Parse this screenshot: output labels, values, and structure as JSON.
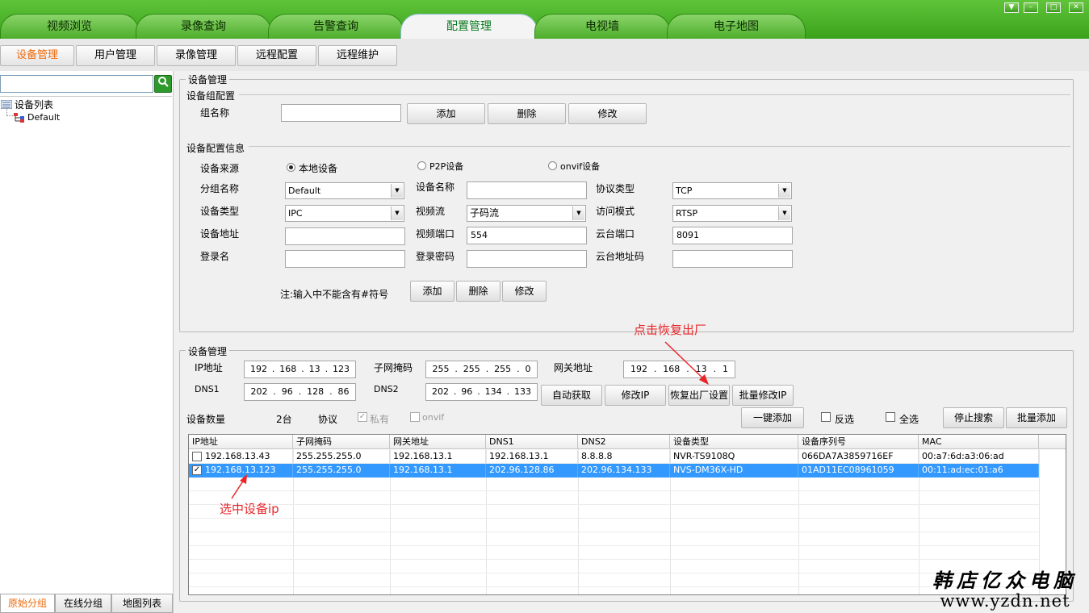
{
  "main_tabs": [
    "视频浏览",
    "录像查询",
    "告警查询",
    "配置管理",
    "电视墙",
    "电子地图"
  ],
  "window_controls": [
    "▼",
    "–",
    "□",
    "✕"
  ],
  "sub_tabs": [
    "设备管理",
    "用户管理",
    "录像管理",
    "远程配置",
    "远程维护"
  ],
  "sidebar": {
    "search_placeholder": "",
    "tree_root": "设备列表",
    "tree_child": "Default",
    "bottom_tabs": [
      "原始分组",
      "在线分组",
      "地图列表"
    ]
  },
  "device_mgmt": {
    "title": "设备管理",
    "group_config": "设备组配置",
    "group_name_label": "组名称",
    "group_buttons": [
      "添加",
      "删除",
      "修改"
    ],
    "config_info": "设备配置信息",
    "source_label": "设备来源",
    "sources": [
      "本地设备",
      "P2P设备",
      "onvif设备"
    ],
    "labels": {
      "group": "分组名称",
      "device_name": "设备名称",
      "protocol_type": "协议类型",
      "device_type": "设备类型",
      "stream": "视频流",
      "access_mode": "访问模式",
      "address": "设备地址",
      "video_port": "视频端口",
      "ptz_port": "云台端口",
      "login": "登录名",
      "password": "登录密码",
      "ptz_addr": "云台地址码"
    },
    "values": {
      "group": "Default",
      "device_name": "",
      "protocol_type": "TCP",
      "device_type": "IPC",
      "stream": "子码流",
      "access_mode": "RTSP",
      "address": "",
      "video_port": "554",
      "ptz_port": "8091",
      "login": "",
      "password": "",
      "ptz_addr": ""
    },
    "note": "注:输入中不能含有#符号",
    "info_buttons": [
      "添加",
      "删除",
      "修改"
    ]
  },
  "network": {
    "title": "设备管理",
    "labels": {
      "ip": "IP地址",
      "mask": "子网掩码",
      "gateway": "网关地址",
      "dns1": "DNS1",
      "dns2": "DNS2"
    },
    "ip": [
      "192",
      "168",
      "13",
      "123"
    ],
    "mask": [
      "255",
      "255",
      "255",
      "0"
    ],
    "gateway": [
      "192",
      "168",
      "13",
      "1"
    ],
    "dns1": [
      "202",
      "96",
      "128",
      "86"
    ],
    "dns2": [
      "202",
      "96",
      "134",
      "133"
    ],
    "buttons": [
      "自动获取",
      "修改IP",
      "恢复出厂设置",
      "批量修改IP"
    ],
    "count_label": "设备数量",
    "count_value": "2台",
    "protocol_label": "协议",
    "protocols": [
      "私有",
      "onvif"
    ],
    "action_buttons": [
      "一键添加",
      "反选",
      "全选",
      "停止搜索",
      "批量添加"
    ]
  },
  "table": {
    "headers": [
      "IP地址",
      "子网掩码",
      "网关地址",
      "DNS1",
      "DNS2",
      "设备类型",
      "设备序列号",
      "MAC"
    ],
    "rows": [
      {
        "checked": false,
        "cells": [
          "192.168.13.43",
          "255.255.255.0",
          "192.168.13.1",
          "192.168.13.1",
          "8.8.8.8",
          "NVR-TS9108Q",
          "066DA7A3859716EF",
          "00:a7:6d:a3:06:ad"
        ]
      },
      {
        "checked": true,
        "cells": [
          "192.168.13.123",
          "255.255.255.0",
          "192.168.13.1",
          "202.96.128.86",
          "202.96.134.133",
          "NVS-DM36X-HD",
          "01AD11EC08961059",
          "00:11:ad:ec:01:a6"
        ]
      }
    ]
  },
  "annotations": {
    "restore": "点击恢复出厂",
    "select": "选中设备ip"
  },
  "watermark": {
    "line1": "韩店亿众电脑",
    "line2": "www.yzdn.net"
  },
  "colors": {
    "accent": "#ee6b0c",
    "selected_row": "#3399ff",
    "annotation": "#e8262a"
  }
}
